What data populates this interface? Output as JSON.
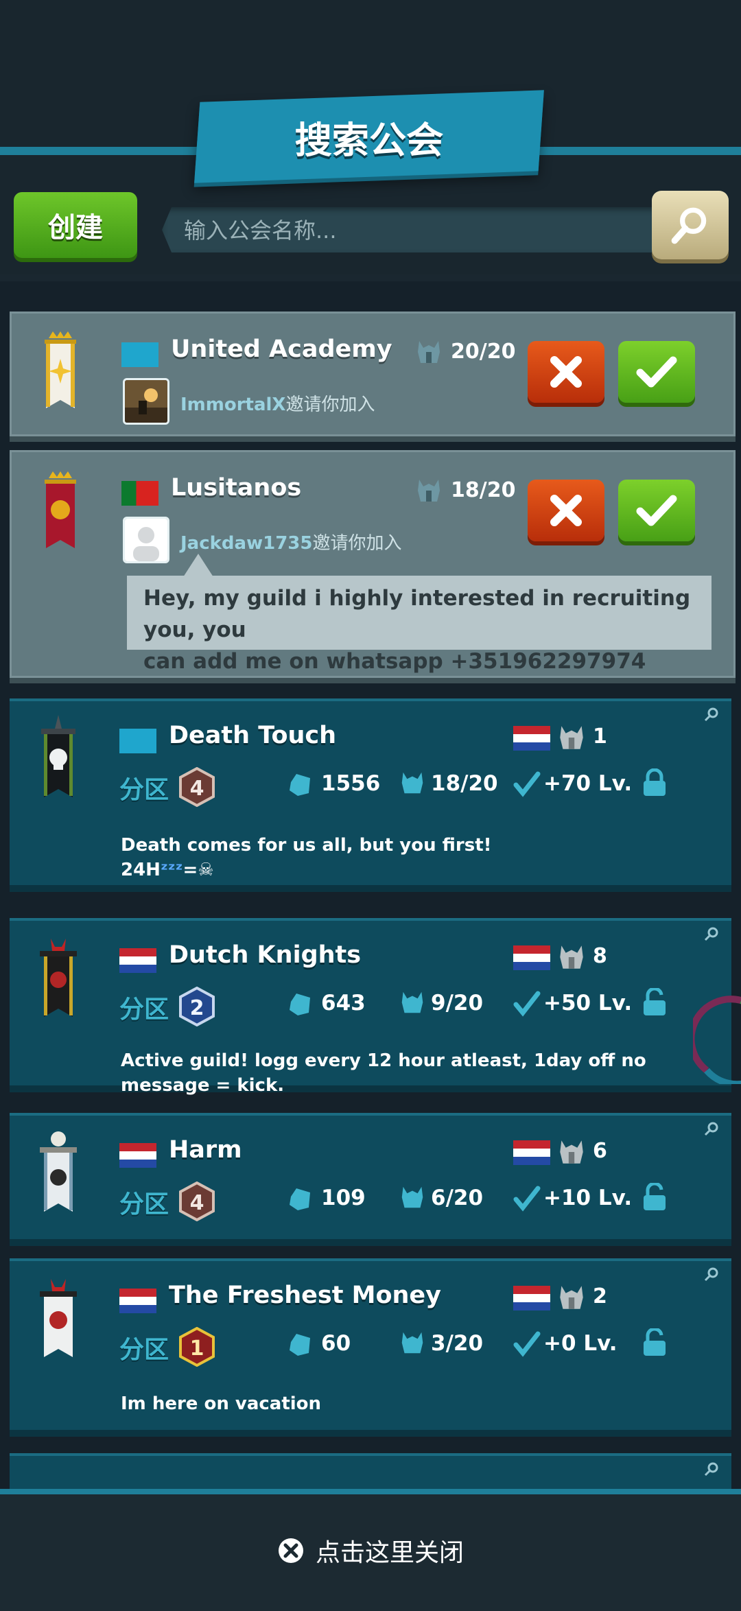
{
  "title": "搜索公会",
  "create_label": "创建",
  "search": {
    "placeholder": "输入公会名称..."
  },
  "invites": [
    {
      "name": "United Academy",
      "flag": "world",
      "members": "20/20",
      "inviter": "ImmortalX",
      "invite_text": "邀请你加入",
      "message": ""
    },
    {
      "name": "Lusitanos",
      "flag": "pt",
      "members": "18/20",
      "inviter": "Jackdaw1735",
      "invite_text": "邀请你加入",
      "message_line1": "Hey, my guild i highly interested in recruiting you, you",
      "message_line2": "can add me on whatsapp   +351962297974"
    }
  ],
  "guilds": [
    {
      "name": "Death Touch",
      "flag": "world",
      "region_flag": "nl",
      "region_count": "1",
      "zone_label": "分区",
      "zone": "4",
      "power": "1556",
      "members": "18/20",
      "level_req": "+70 Lv.",
      "locked": true,
      "desc_line1": "Death comes for us all, but you first!",
      "desc_line2": "24H",
      "desc_line2_tail": "="
    },
    {
      "name": "Dutch Knights",
      "flag": "nl",
      "region_flag": "nl",
      "region_count": "8",
      "zone_label": "分区",
      "zone": "2",
      "power": "643",
      "members": "9/20",
      "level_req": "+50 Lv.",
      "locked": false,
      "desc_line1": "Active guild! logg every 12 hour atleast, 1day off no message = kick."
    },
    {
      "name": "Harm",
      "flag": "nl",
      "region_flag": "nl",
      "region_count": "6",
      "zone_label": "分区",
      "zone": "4",
      "power": "109",
      "members": "6/20",
      "level_req": "+10 Lv.",
      "locked": false
    },
    {
      "name": "The Freshest Money",
      "flag": "nl",
      "region_flag": "nl",
      "region_count": "2",
      "zone_label": "分区",
      "zone": "1",
      "power": "60",
      "members": "3/20",
      "level_req": "+0 Lv.",
      "locked": false,
      "desc_line1": "Im here on vacation"
    }
  ],
  "close_text": "点击这里关闭",
  "colors": {
    "accent": "#1f7f9a",
    "create": "#5cb520",
    "reject": "#d44512",
    "accept": "#6cc424",
    "card": "#0e4b5d",
    "invite_card": "#627a80"
  }
}
